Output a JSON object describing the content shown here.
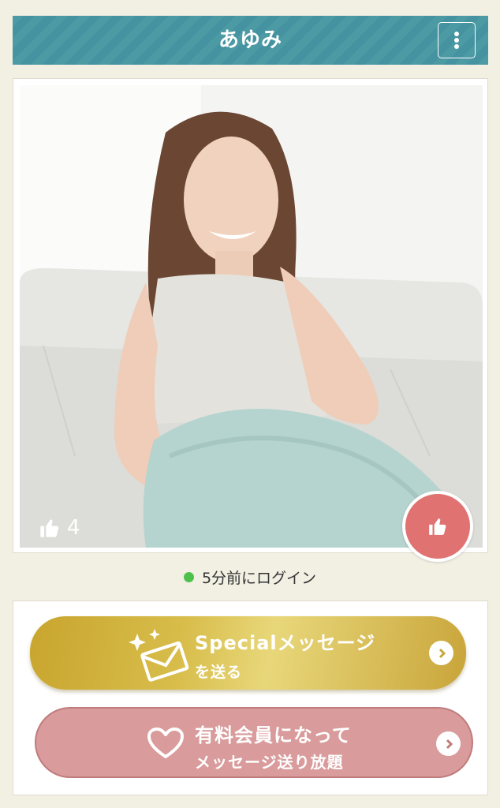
{
  "header": {
    "title": "あゆみ",
    "menu_icon": "kebab-menu-icon"
  },
  "profile": {
    "photo_alt": "Profile photo",
    "like_count": "4",
    "like_icon": "thumbs-up-icon",
    "status_text": "5分前にログイン",
    "status_color": "#4cc24c"
  },
  "actions": {
    "special": {
      "line1": "Specialメッセージ",
      "line2": "を送る",
      "icon": "envelope-sparkle-icon"
    },
    "member": {
      "line1": "有料会員になって",
      "line2": "メッセージ送り放題",
      "icon": "heart-icon"
    }
  },
  "colors": {
    "header": "#4b9aa4",
    "gold": "#d8bd4b",
    "pink": "#d99b9b",
    "like": "#e07272"
  }
}
